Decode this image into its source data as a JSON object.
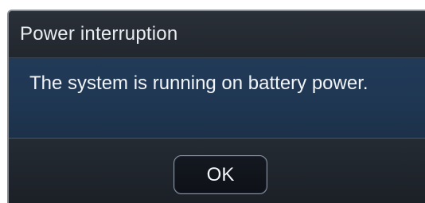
{
  "dialog": {
    "title": "Power interruption",
    "message": "The system is running on battery power.",
    "ok_label": "OK"
  }
}
